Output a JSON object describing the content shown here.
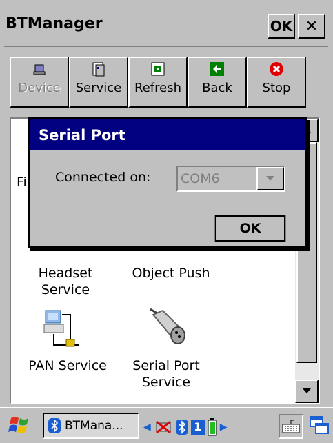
{
  "window": {
    "title": "BTManager",
    "ok_label": "OK",
    "close_glyph": "✕"
  },
  "toolbar": [
    {
      "label": "Device",
      "icon": "device-icon",
      "enabled": false
    },
    {
      "label": "Service",
      "icon": "service-icon",
      "enabled": true
    },
    {
      "label": "Refresh",
      "icon": "refresh-icon",
      "enabled": true
    },
    {
      "label": "Back",
      "icon": "back-arrow-icon",
      "enabled": true
    },
    {
      "label": "Stop",
      "icon": "stop-icon",
      "enabled": true
    }
  ],
  "services": {
    "partial_label": "Fi",
    "headset": {
      "line1": "Headset",
      "line2": "Service"
    },
    "object_push": "Object Push",
    "pan": "PAN Service",
    "serial": {
      "line1": "Serial Port",
      "line2": "Service"
    }
  },
  "dialog": {
    "title": "Serial Port",
    "connected_label": "Connected on:",
    "port_value": "COM6",
    "ok_label": "OK"
  },
  "taskbar": {
    "task_label": "BTMana...",
    "battery_level": "1"
  },
  "colors": {
    "title_blue": "#000080",
    "face": "#c0c0c0",
    "stop_red": "#e00000",
    "back_green": "#008000"
  }
}
